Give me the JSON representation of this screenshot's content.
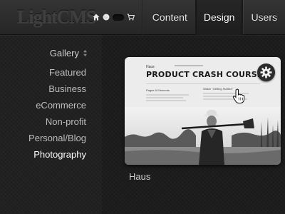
{
  "app": {
    "logo": "LightCMS"
  },
  "header": {
    "icons": [
      "home-icon",
      "globe-icon",
      "toggle-pill-icon",
      "cart-icon"
    ],
    "nav": [
      {
        "label": "Content",
        "active": false
      },
      {
        "label": "Design",
        "active": true
      },
      {
        "label": "Users",
        "active": false
      }
    ]
  },
  "sidebar": {
    "heading": "Gallery",
    "heading_icon": "sort-updown-icon",
    "items": [
      {
        "label": "Featured"
      },
      {
        "label": "Business"
      },
      {
        "label": "eCommerce"
      },
      {
        "label": "Non-profit"
      },
      {
        "label": "Personal/Blog"
      },
      {
        "label": "Photography",
        "active": true
      }
    ]
  },
  "gallery": {
    "theme_name": "Haus",
    "preview": {
      "brand": "Haus",
      "title": "PRODUCT CRASH COURSE...",
      "sub_left": "Pages & Elements",
      "sub_right": "Watch \"Getting Started\""
    },
    "settings_icon": "gear-icon"
  },
  "colors": {
    "background": "#1f1f1f",
    "topbar": "#2e2e2e",
    "active_nav": "#222222",
    "text": "#cccccc"
  }
}
